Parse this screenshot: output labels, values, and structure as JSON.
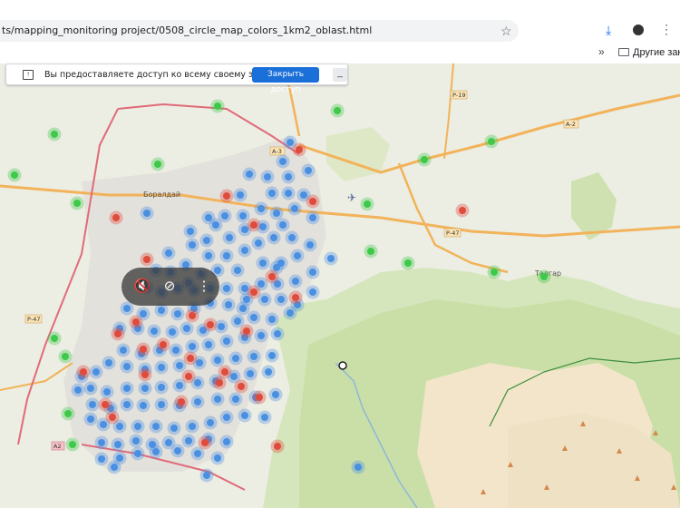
{
  "browser": {
    "url": "ts/mapping_monitoring project/0508_circle_map_colors_1km2_oblast.html",
    "bookmarks_folder": "Другие закл",
    "icons": [
      "star-icon",
      "download-icon",
      "extension-icon",
      "menu-icon",
      "chevron-right-icon",
      "folder-icon"
    ]
  },
  "screen_share": {
    "message": "Вы предоставляете доступ ко всему своему экрану.",
    "stop_label": "Закрыть доступ",
    "hide_label": "_"
  },
  "map": {
    "road_labels": [
      "Р-19",
      "А-2",
      "А-3",
      "Р-47",
      "Р-47",
      "А2"
    ],
    "place_labels": [
      "Боралдай",
      "Талгар"
    ],
    "colors": {
      "blue": "#4a90e2",
      "red": "#e04b3c",
      "green": "#3ec94a",
      "forest": "#cfe1b0",
      "mountain": "#f3e3c7",
      "road": "#f2b35a",
      "highway": "#e06b7a"
    }
  },
  "video_controls": {
    "icons": [
      "mute-icon",
      "no-captions-icon",
      "more-options-icon"
    ]
  }
}
